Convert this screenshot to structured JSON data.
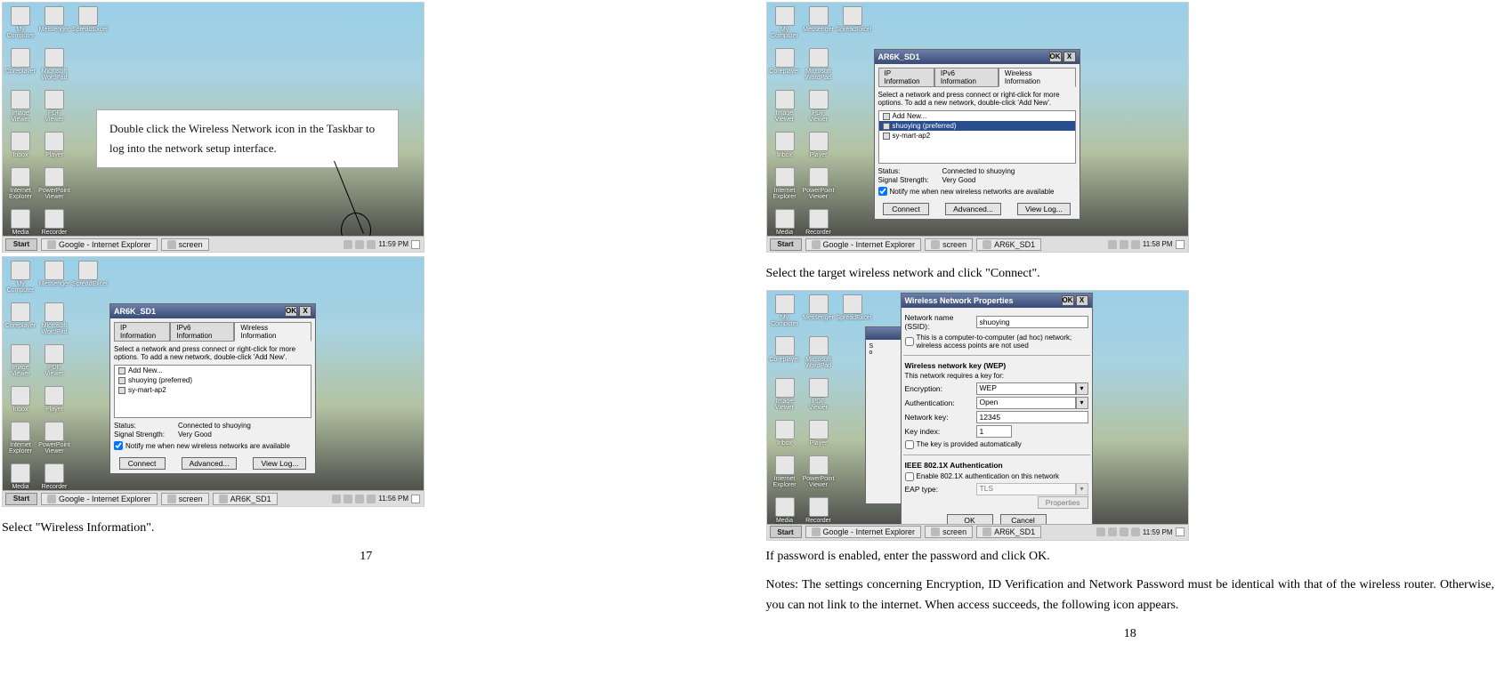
{
  "page_numbers": {
    "left": "17",
    "right": "18"
  },
  "callout": {
    "text": "Double click the Wireless Network icon in the Taskbar to log into the network setup interface."
  },
  "desktop_icons": [
    "My\nComputer",
    "Messenger",
    "SpreadExcel",
    "Coreplayer",
    "Microsoft\nWordPad",
    "",
    "Image\nViewer",
    "PDF Viewer",
    "",
    "Inbox",
    "Player",
    "",
    "Internet\nExplorer",
    "PowerPoint\nViewer",
    "",
    "Media Player",
    "Recorder",
    ""
  ],
  "taskbar": {
    "start": "Start",
    "buttons": [
      "Google - Internet Explorer",
      "screen"
    ]
  },
  "taskbar_time": {
    "a": "11:59 PM",
    "b": "11:56 PM",
    "c": "11:58 PM",
    "d": "11:59 PM"
  },
  "dlg": {
    "title": "AR6K_SD1",
    "ok": "OK",
    "x": "X",
    "tab1": "IP Information",
    "tab2": "IPv6 Information",
    "tab3": "Wireless Information",
    "help": "Select a network and press connect or right-click for more options.  To add a new network, double-click 'Add New'.",
    "net_addnew": "Add New...",
    "net_pref": "shuoying (preferred)",
    "net_ap2": "sy-mart-ap2",
    "status_lbl": "Status:",
    "status_val": "Connected to shuoying",
    "sig_lbl": "Signal Strength:",
    "sig_val": "Very Good",
    "notify": "Notify me when new wireless networks are available",
    "btn_connect": "Connect",
    "btn_advanced": "Advanced...",
    "btn_viewlog": "View Log..."
  },
  "taskbar_extra_btn": "AR6K_SD1",
  "caption_left": "Select \"Wireless Information\".",
  "caption_r1": "Select the target wireless network and click \"Connect\".",
  "caption_r2": "If password is enabled, enter the password and click OK.",
  "caption_r3": "Notes: The settings concerning Encryption, ID Verification and Network Password must be identical with that of the wireless router. Otherwise, you can not link to the internet. When access succeeds, the following icon appears.",
  "prop": {
    "title": "Wireless Network Properties",
    "ok": "OK",
    "x": "X",
    "ssid_lbl": "Network name (SSID):",
    "ssid_val": "shuoying",
    "adhoc": "This is a computer-to-computer (ad hoc) network; wireless access points are not used",
    "wep_h": "Wireless network key (WEP)",
    "wep_sub": "This network requires a key for:",
    "enc_lbl": "Encryption:",
    "enc_val": "WEP",
    "auth_lbl": "Authentication:",
    "auth_val": "Open",
    "key_lbl": "Network key:",
    "key_val": "12345",
    "idx_lbl": "Key index:",
    "idx_val": "1",
    "auto": "The key is provided automatically",
    "ieee_h": "IEEE 802.1X Authentication",
    "ieee_enable": "Enable 802.1X authentication on this network",
    "eap_lbl": "EAP type:",
    "eap_val": "TLS",
    "btn_props": "Properties",
    "btn_ok": "OK",
    "btn_cancel": "Cancel"
  }
}
